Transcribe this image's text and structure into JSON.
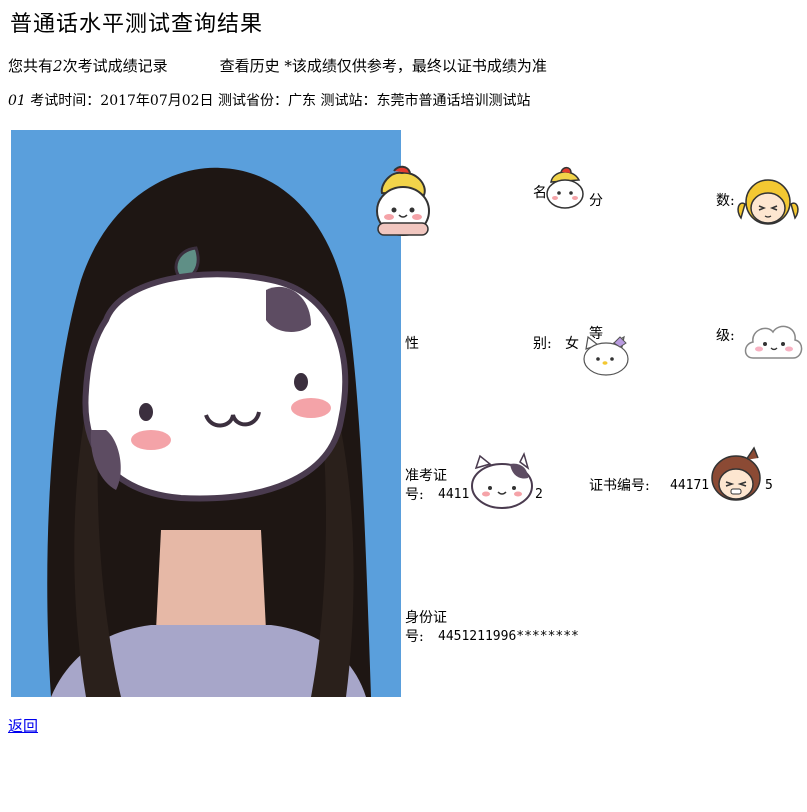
{
  "page": {
    "title": "普通话水平测试查询结果"
  },
  "summary": {
    "prefix": "您共有",
    "count": "2",
    "suffix": "次考试成绩记录",
    "history_link": "查看历史",
    "note": "*该成绩仅供参考，最终以证书成绩为准"
  },
  "exam": {
    "index": "01",
    "date_label": "考试时间：",
    "date": "2017年07月02日",
    "province_label": "测试省份：",
    "province": "广东",
    "station_label": "测试站：",
    "station": "东莞市普通话培训测试站"
  },
  "details": {
    "name_label": "名",
    "score_label": "分",
    "score_label_end": "数:",
    "gender_label": "性",
    "gender_label_end": "别:",
    "gender_value": "女",
    "grade_label": "等",
    "grade_label_end": "级:",
    "ticket_label_1": "准考证",
    "ticket_label_2": "号:",
    "ticket_value_visible": "4411",
    "ticket_value_end": "2",
    "cert_label": "证书编号:",
    "cert_value_visible": "44171",
    "cert_value_end": "5",
    "id_label_1": "身份证",
    "id_label_2": "号:",
    "id_value": "4451211996********"
  },
  "footer": {
    "back_link": "返回"
  },
  "stickers": [
    "cat-sticker",
    "chick-sticker",
    "blonde-girl-sticker",
    "kitty-sticker",
    "cloud-sticker",
    "girl-brown-hair-sticker"
  ]
}
